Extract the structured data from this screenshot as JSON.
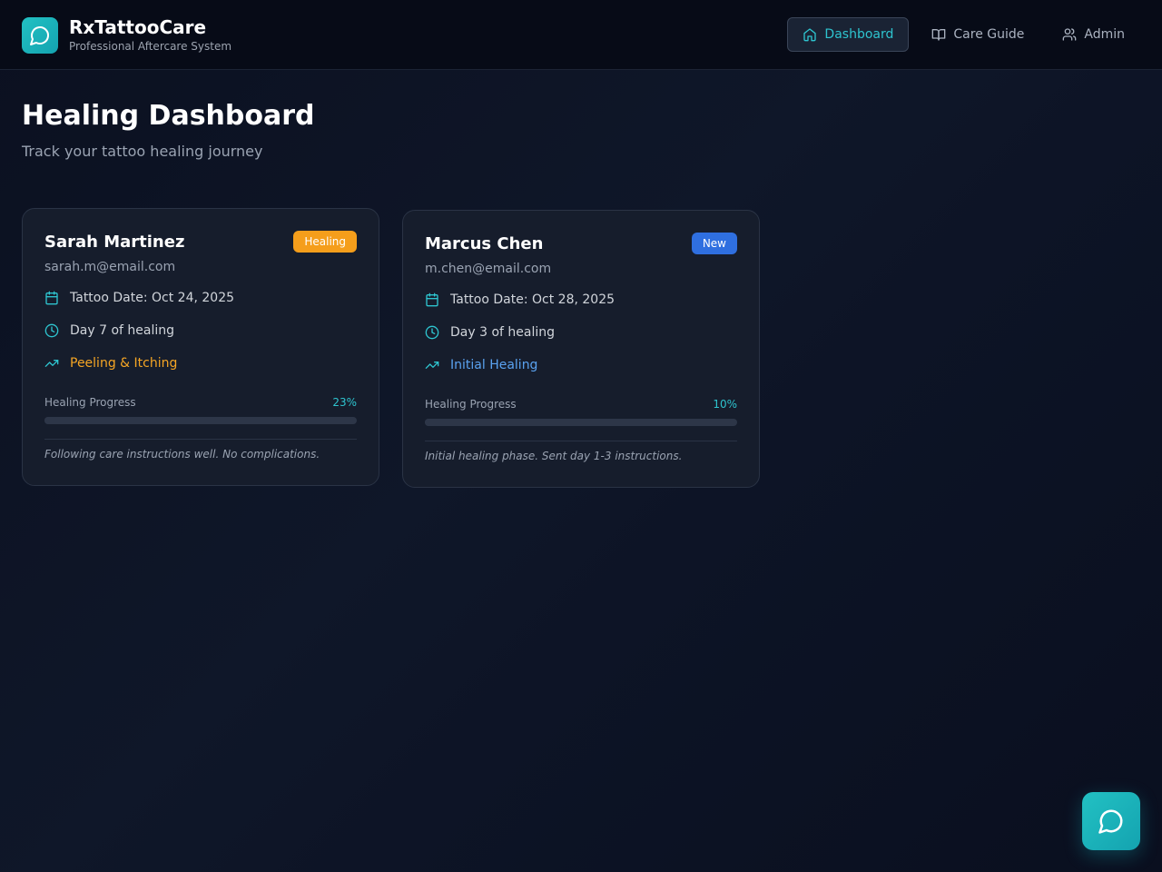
{
  "app": {
    "title": "RxTattooCare",
    "subtitle": "Professional Aftercare System",
    "accent": "#22c1c3"
  },
  "nav": {
    "items": [
      {
        "label": "Dashboard",
        "icon": "home-icon",
        "active": true
      },
      {
        "label": "Care Guide",
        "icon": "book-open-icon",
        "active": false
      },
      {
        "label": "Admin",
        "icon": "users-icon",
        "active": false
      }
    ]
  },
  "page": {
    "title": "Healing Dashboard",
    "subtitle": "Track your tattoo healing journey"
  },
  "clients": [
    {
      "name": "Sarah Martinez",
      "email": "sarah.m@email.com",
      "badge": "Healing",
      "badge_color": "#f59e1b",
      "tattoo_date": "Tattoo Date: Oct 24, 2025",
      "day": "Day 7 of healing",
      "stage": "Peeling & Itching",
      "stage_color": "#f5a524",
      "progress_label": "Healing Progress",
      "progress_pct": "23%",
      "progress_value": 0.23,
      "note": "Following care instructions well. No complications."
    },
    {
      "name": "Marcus Chen",
      "email": "m.chen@email.com",
      "badge": "New",
      "badge_color": "#2f6fe0",
      "tattoo_date": "Tattoo Date: Oct 28, 2025",
      "day": "Day 3 of healing",
      "stage": "Initial Healing",
      "stage_color": "#5aa2f0",
      "progress_label": "Healing Progress",
      "progress_pct": "10%",
      "progress_value": 0.1,
      "note": "Initial healing phase. Sent day 1-3 instructions."
    }
  ],
  "fab": {
    "icon": "chat-bubble-icon"
  }
}
